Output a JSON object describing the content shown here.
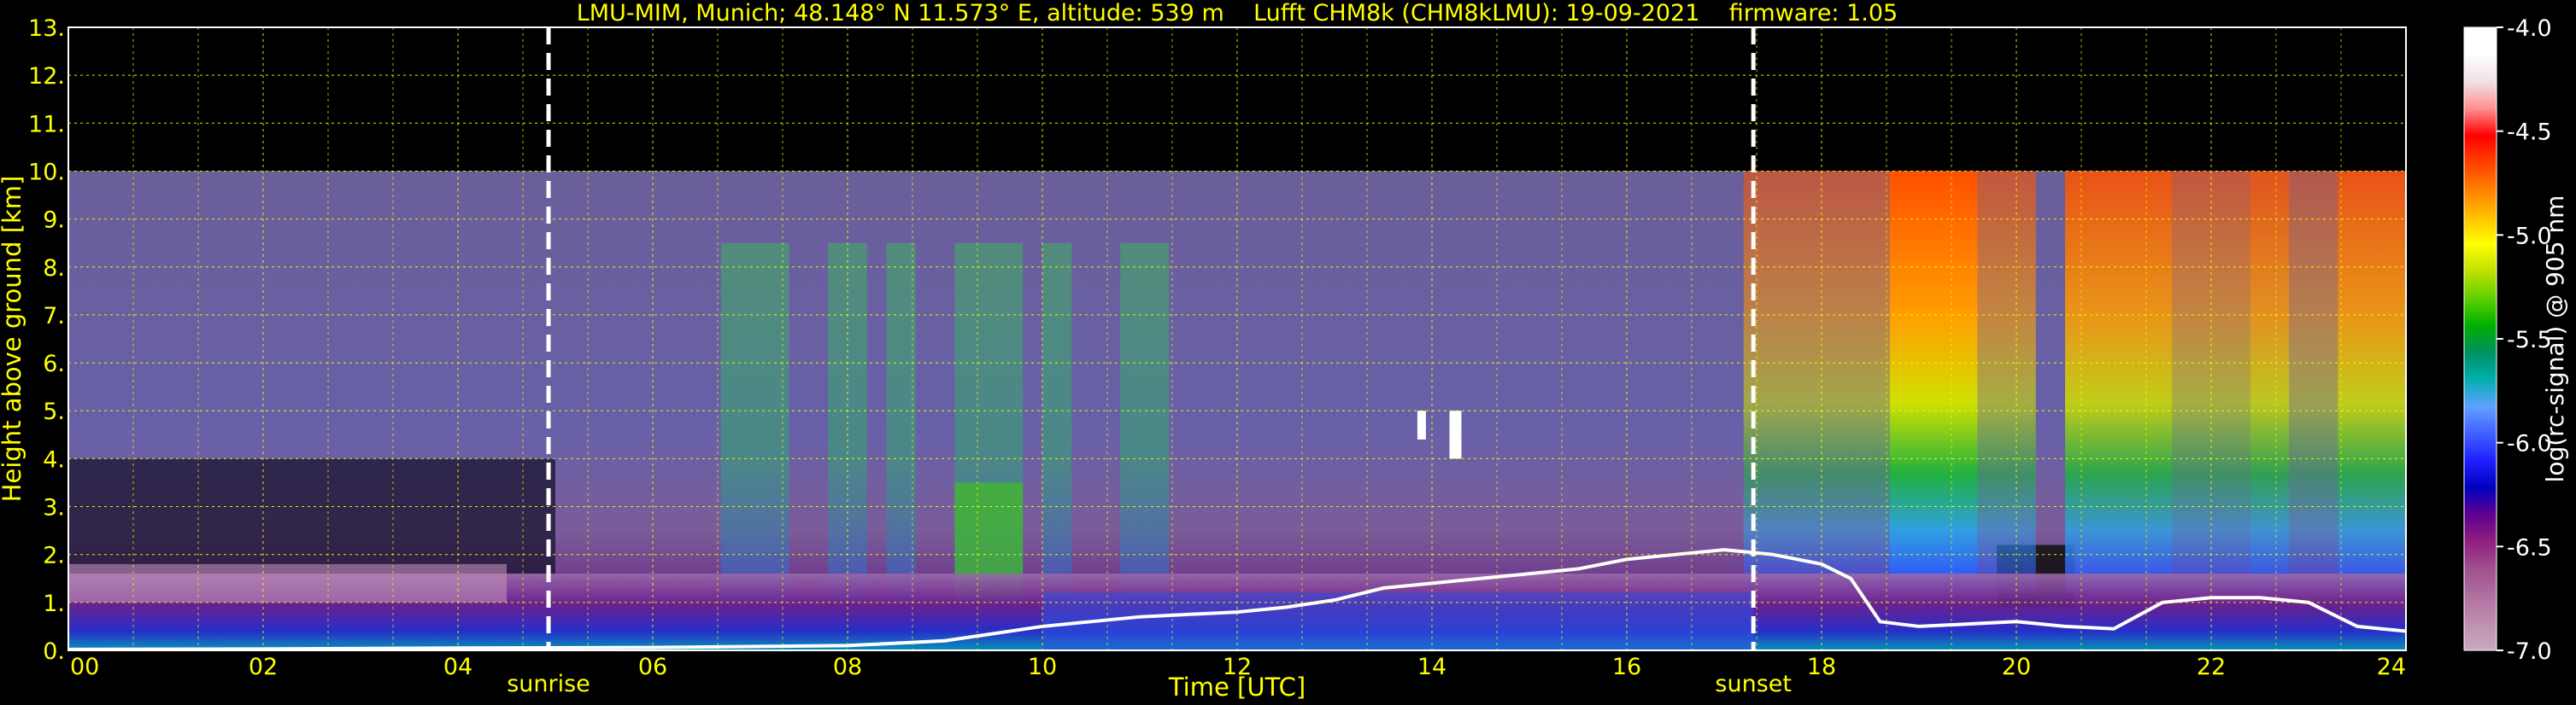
{
  "chart_data": {
    "type": "heatmap",
    "title": "LMU-MIM, Munich; 48.148° N 11.573° E, altitude: 539 m    Lufft CHM8k (CHM8kLMU): 19-09-2021    firmware: 1.05",
    "xlabel": "Time [UTC]",
    "ylabel": "Height above ground [km]",
    "xlim": [
      0,
      24
    ],
    "ylim": [
      0,
      13
    ],
    "x_ticks": [
      "00",
      "02",
      "04",
      "06",
      "08",
      "10",
      "12",
      "14",
      "16",
      "18",
      "20",
      "22",
      "24"
    ],
    "y_ticks": [
      "0.",
      "1.",
      "2.",
      "3.",
      "4.",
      "5.",
      "6.",
      "7.",
      "8.",
      "9.",
      "10.",
      "11.",
      "12.",
      "13."
    ],
    "grid": true,
    "data_max_height_km": 10,
    "annotations": [
      {
        "label": "sunrise",
        "x": 4.93
      },
      {
        "label": "sunset",
        "x": 17.3
      }
    ],
    "colorbar": {
      "label": "log(rc-signal) @ 905 nm",
      "range": [
        -7.0,
        -4.0
      ],
      "ticks": [
        "-4.0",
        "-4.5",
        "-5.0",
        "-5.5",
        "-6.0",
        "-6.5",
        "-7.0"
      ],
      "colors": [
        "#ffffff",
        "#ffffff",
        "#f0e0e8",
        "#ff9090",
        "#ff0000",
        "#ff4000",
        "#ff8000",
        "#ffc000",
        "#ffff00",
        "#c0e000",
        "#60d000",
        "#00b000",
        "#009060",
        "#00b0b0",
        "#60a0ff",
        "#4060ff",
        "#2020ff",
        "#0000c0",
        "#600090",
        "#902080",
        "#a05090",
        "#b070a0",
        "#c090b0",
        "#c8a8c0"
      ]
    },
    "cloud_base_km": [
      [
        0,
        0.02
      ],
      [
        2,
        0.03
      ],
      [
        4,
        0.05
      ],
      [
        6,
        0.06
      ],
      [
        8,
        0.1
      ],
      [
        9,
        0.2
      ],
      [
        10,
        0.5
      ],
      [
        10.5,
        0.6
      ],
      [
        11,
        0.7
      ],
      [
        12,
        0.8
      ],
      [
        12.5,
        0.9
      ],
      [
        13,
        1.05
      ],
      [
        13.5,
        1.3
      ],
      [
        14,
        1.4
      ],
      [
        14.5,
        1.5
      ],
      [
        15,
        1.6
      ],
      [
        15.5,
        1.7
      ],
      [
        16,
        1.9
      ],
      [
        16.5,
        2.0
      ],
      [
        17,
        2.1
      ],
      [
        17.5,
        2.0
      ],
      [
        18,
        1.8
      ],
      [
        18.3,
        1.5
      ],
      [
        18.6,
        0.6
      ],
      [
        19,
        0.5
      ],
      [
        19.5,
        0.55
      ],
      [
        20,
        0.6
      ],
      [
        20.5,
        0.5
      ],
      [
        21,
        0.45
      ],
      [
        21.5,
        1.0
      ],
      [
        22,
        1.1
      ],
      [
        22.5,
        1.1
      ],
      [
        23,
        1.0
      ],
      [
        23.5,
        0.5
      ],
      [
        24,
        0.4
      ]
    ]
  }
}
